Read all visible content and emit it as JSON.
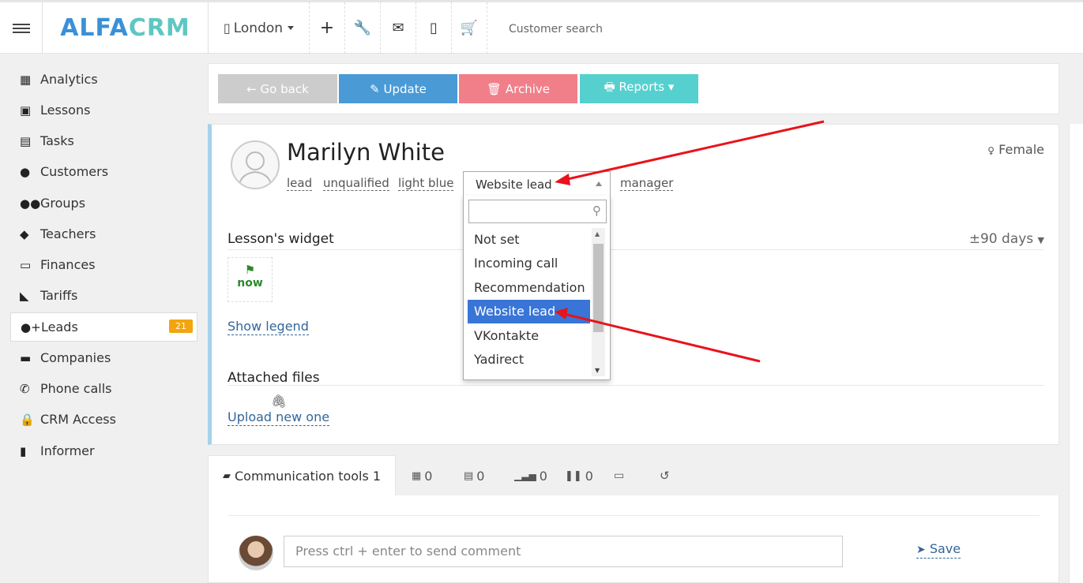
{
  "topbar": {
    "logo_part1": "ALFA",
    "logo_part2": "CRM",
    "branch": "London",
    "search_placeholder": "Customer search"
  },
  "sidebar": {
    "items": [
      {
        "label": "Analytics",
        "icon": "map-icon"
      },
      {
        "label": "Lessons",
        "icon": "calendar-icon"
      },
      {
        "label": "Tasks",
        "icon": "clipboard-icon"
      },
      {
        "label": "Customers",
        "icon": "user-icon"
      },
      {
        "label": "Groups",
        "icon": "users-icon"
      },
      {
        "label": "Teachers",
        "icon": "graduation-cap-icon"
      },
      {
        "label": "Finances",
        "icon": "money-icon"
      },
      {
        "label": "Tariffs",
        "icon": "tag-icon"
      },
      {
        "label": "Leads",
        "icon": "user-plus-icon",
        "badge": "21",
        "active": true
      },
      {
        "label": "Companies",
        "icon": "briefcase-icon"
      },
      {
        "label": "Phone calls",
        "icon": "phone-icon"
      },
      {
        "label": "CRM Access",
        "icon": "lock-icon"
      },
      {
        "label": "Informer",
        "icon": "book-icon"
      }
    ]
  },
  "actions": {
    "back": "← Go back",
    "update": "✎ Update",
    "archive": "🗑 Archive",
    "reports": "🖶 Reports ▾"
  },
  "profile": {
    "name": "Marilyn White",
    "gender": "Female",
    "tags": [
      "lead",
      "unqualified",
      "light blue"
    ],
    "source_selected": "Website lead",
    "manager": "manager"
  },
  "dropdown": {
    "options": [
      "Not set",
      "Incoming call",
      "Recommendation",
      "Website lead",
      "VKontakte",
      "Yadirect"
    ],
    "selected_index": 3
  },
  "widget": {
    "title": "Lesson's widget",
    "range": "±90 days",
    "now_label": "now",
    "show_legend": "Show legend"
  },
  "files": {
    "title": "Attached files",
    "upload": "Upload new one"
  },
  "tabs": {
    "communication": "Communication tools 1",
    "lessons_count": "0",
    "tasks_count": "0",
    "stats_count": "0",
    "pause_count": "0"
  },
  "comment": {
    "placeholder": "Press ctrl + enter to send comment",
    "save": "Save"
  },
  "colors": {
    "update": "#4a9ad6",
    "archive": "#f07f89",
    "reports": "#56d0cf",
    "back": "#cccccc",
    "selected_option": "#3875d7",
    "badge": "#f3a50f"
  }
}
